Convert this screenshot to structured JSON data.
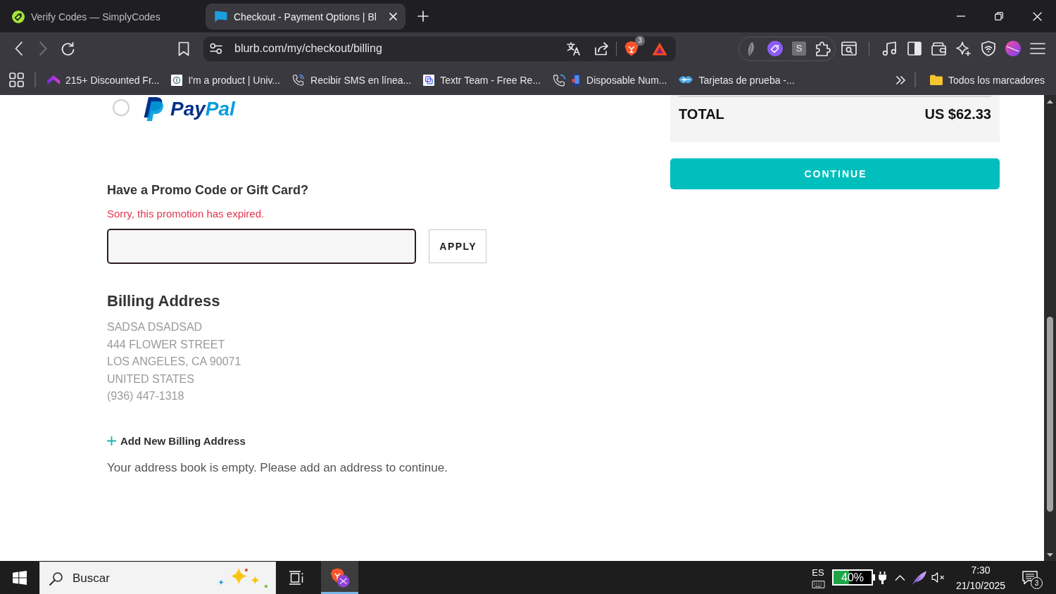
{
  "browser": {
    "tabs": [
      {
        "kind": "tag",
        "title": "Verify Codes — SimplyCodes",
        "selected": false
      },
      {
        "kind": "chat",
        "title": "Checkout - Payment Options | Bl",
        "selected": true
      }
    ],
    "nav_buttons": [
      {
        "kind": "back",
        "disabled": false
      },
      {
        "kind": "forward",
        "disabled": true
      },
      {
        "kind": "reload",
        "disabled": false
      }
    ],
    "address_bar": {
      "url": "blurb.com/my/checkout/billing"
    },
    "shields_count": "3",
    "extension_label": "S",
    "bookmarks": [
      {
        "kind": "roof",
        "label": "215+ Discounted Fr..."
      },
      {
        "kind": "circle",
        "label": "I'm a product | Univ..."
      },
      {
        "kind": "phone",
        "label": "Recibir SMS en línea..."
      },
      {
        "kind": "squares",
        "label": "Textr Team - Free Re..."
      },
      {
        "kind": "phones",
        "label": "Disposable Num..."
      },
      {
        "kind": "handshake",
        "label": "Tarjetas de prueba -..."
      }
    ],
    "bookmarks_folder": "Todos los marcadores"
  },
  "checkout": {
    "payment_options": [
      {
        "kind": "paypal",
        "label": "PayPal",
        "selected": false
      }
    ],
    "promo": {
      "heading": "Have a Promo Code or Gift Card?",
      "error": "Sorry, this promotion has expired.",
      "apply_button": "APPLY"
    },
    "billing": {
      "heading": "Billing Address",
      "address_lines": [
        "SADSA DSADSAD",
        "444 FLOWER STREET",
        "LOS ANGELES, CA 90071",
        "UNITED STATES",
        "(936) 447-1318"
      ],
      "add_address_link": "Add New Billing Address",
      "notice": "Your address book is empty. Please add an address to continue."
    },
    "summary": {
      "total_label": "TOTAL",
      "total_value": "US $62.33",
      "continue_button": "CONTINUE"
    }
  },
  "taskbar": {
    "search": {
      "placeholder": "Buscar"
    },
    "apps": [
      {
        "kind": "task-view",
        "selected": false
      },
      {
        "kind": "browser",
        "selected": true
      }
    ],
    "language": "ES",
    "battery": {
      "level": 0.4,
      "reading": "40%"
    },
    "clock": {
      "time": "7:30",
      "date": "21/10/2025"
    },
    "notifications_count": "3"
  }
}
